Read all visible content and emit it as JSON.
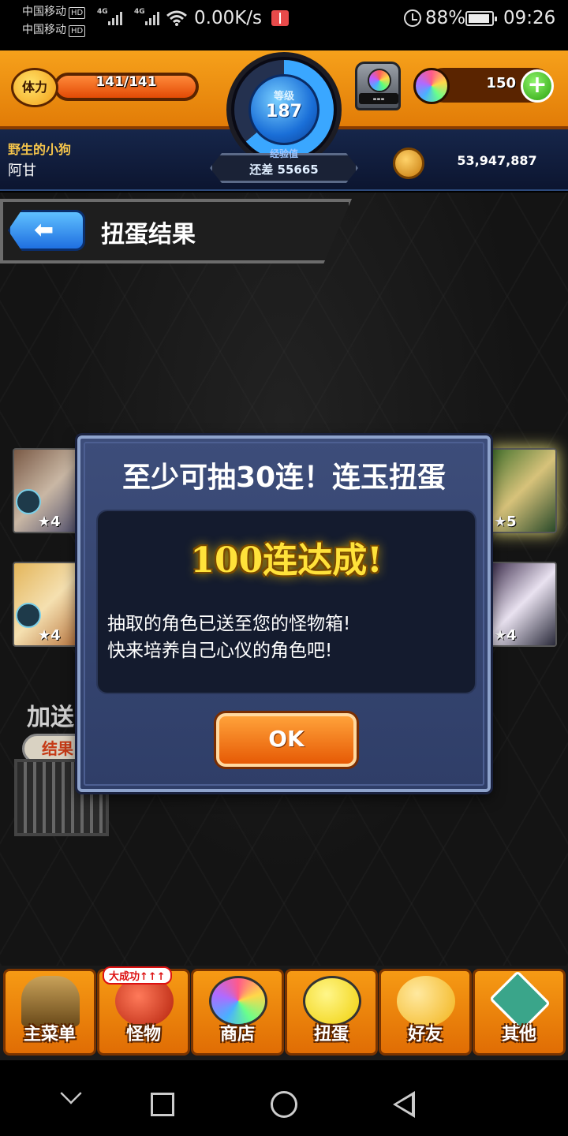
{
  "status_bar": {
    "carrier_1": "中国移动",
    "carrier_2": "中国移动",
    "hd_badge": "HD",
    "network_type": "4G",
    "net_speed": "0.00K/s",
    "battery_percent": "88%",
    "time": "09:26",
    "icons": [
      "signal-icon",
      "wifi-icon",
      "book-app-icon",
      "alarm-icon",
      "battery-icon"
    ]
  },
  "hud": {
    "stamina_label": "体力",
    "stamina_value": "141/141",
    "stamina_fraction": 1.0,
    "level_caption": "等级",
    "level": "187",
    "exp_caption": "经验值",
    "exp_remaining": "还差 55665",
    "box_label": "---",
    "orb_count": "150",
    "orb_add_label": "+",
    "user_title": "野生的小狗",
    "user_name": "阿甘",
    "gold": "53,947,887"
  },
  "screen": {
    "back_label": "⬅",
    "title": "扭蛋结果"
  },
  "cards": [
    {
      "stars": "★4"
    },
    {
      "stars": "★4"
    },
    {
      "stars": "★5"
    },
    {
      "stars": "★4"
    }
  ],
  "bonus": {
    "text": "加送",
    "badge": "结果"
  },
  "dialog": {
    "title": "至少可抽30连！连玉扭蛋",
    "achievement": "100连达成!",
    "message_line_1": "抽取的角色已送至您的怪物箱!",
    "message_line_2": "快来培养自己心仪的角色吧!",
    "ok_label": "OK"
  },
  "menu": {
    "items": [
      {
        "label": "主菜单",
        "icon": "gate-icon"
      },
      {
        "label": "怪物",
        "icon": "monster-icon",
        "tag": "大成功↑↑↑"
      },
      {
        "label": "商店",
        "icon": "rainbow-orb-icon"
      },
      {
        "label": "扭蛋",
        "icon": "gacha-egg-icon"
      },
      {
        "label": "好友",
        "icon": "friends-icon"
      },
      {
        "label": "其他",
        "icon": "question-icon"
      }
    ]
  },
  "colors": {
    "hud_orange": "#f6a11b",
    "hud_navy": "#16264a",
    "dialog_blue": "#3d4d7a",
    "achievement_gold": "#ffe23a",
    "ok_orange": "#e65a05"
  }
}
